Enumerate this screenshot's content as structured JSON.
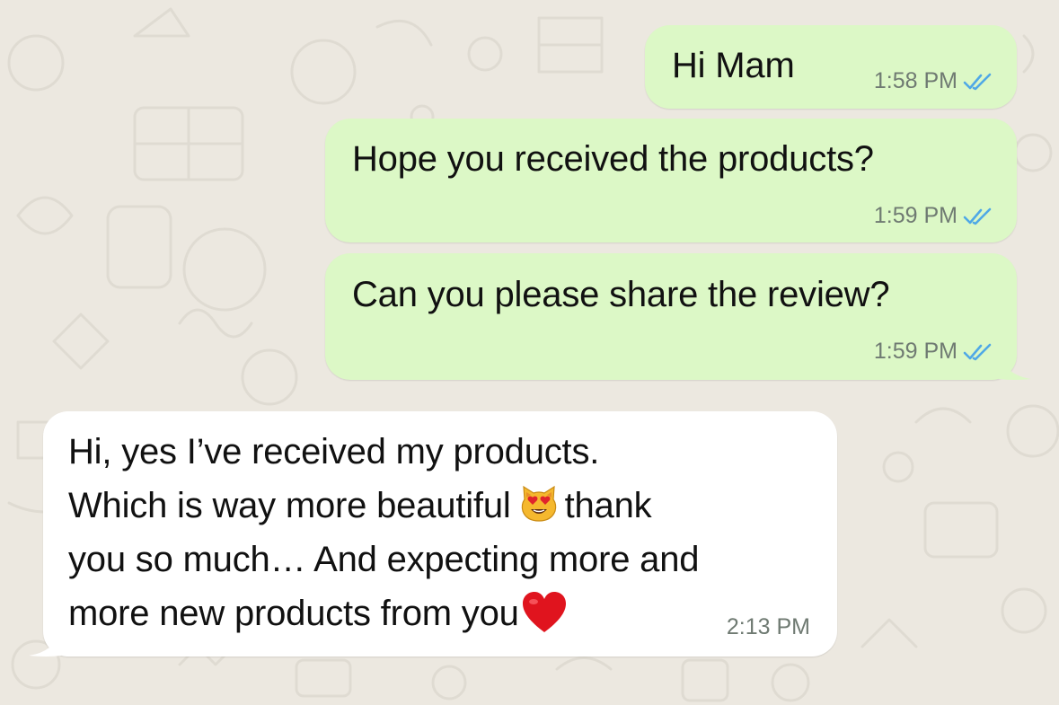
{
  "chat": {
    "messages": [
      {
        "direction": "outgoing",
        "text": "Hi Mam",
        "time": "1:58 PM",
        "status": "read-double-check"
      },
      {
        "direction": "outgoing",
        "text": "Hope you received the products?",
        "time": "1:59 PM",
        "status": "read-double-check"
      },
      {
        "direction": "outgoing",
        "text": "Can you please share the review?",
        "time": "1:59 PM",
        "status": "read-double-check"
      },
      {
        "direction": "incoming",
        "lines": [
          "Hi, yes I’ve received my products.",
          "Which is way more beautiful",
          "thank",
          "you so much… And expecting more and",
          "more new products from you"
        ],
        "emojis": [
          "heart-eyes-cat-emoji",
          "red-heart-emoji"
        ],
        "time": "2:13 PM"
      }
    ]
  },
  "colors": {
    "wallpaper": "#ece8e0",
    "outgoing_bubble": "#dcf8c6",
    "incoming_bubble": "#ffffff",
    "read_tick": "#4fa8e6",
    "timestamp": "#6f7a72"
  }
}
